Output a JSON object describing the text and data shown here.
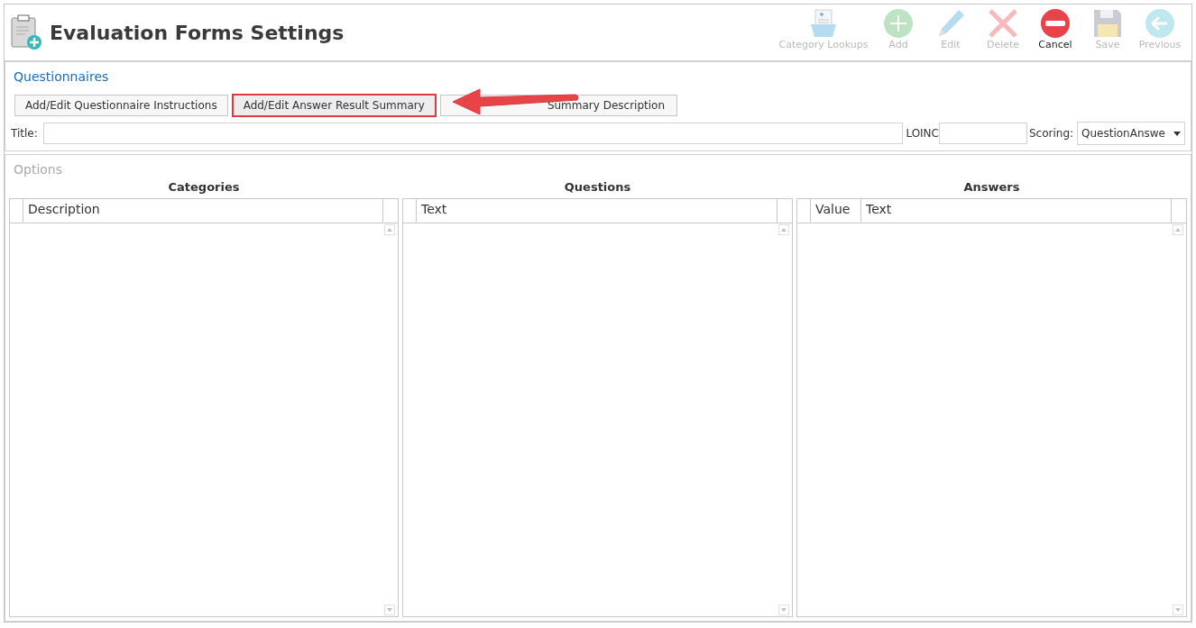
{
  "window": {
    "title": "Evaluation Forms Settings"
  },
  "toolbar": [
    {
      "label": "Category Lookups",
      "kind": "lookups",
      "disabled": true
    },
    {
      "label": "Add",
      "kind": "add",
      "disabled": true
    },
    {
      "label": "Edit",
      "kind": "edit",
      "disabled": true
    },
    {
      "label": "Delete",
      "kind": "delete",
      "disabled": true
    },
    {
      "label": "Cancel",
      "kind": "cancel",
      "disabled": false
    },
    {
      "label": "Save",
      "kind": "save",
      "disabled": true
    },
    {
      "label": "Previous",
      "kind": "previous",
      "disabled": true
    }
  ],
  "questionnaires": {
    "heading": "Questionnaires",
    "buttons": [
      {
        "label": "Add/Edit Questionnaire Instructions",
        "highlighted": false,
        "covered": false
      },
      {
        "label": "Add/Edit Answer Result Summary",
        "highlighted": true,
        "covered": false
      },
      {
        "label": "Summary Description",
        "highlighted": false,
        "covered": true
      }
    ],
    "title_label": "Title:",
    "loinc_label": "LOINC",
    "scoring_label": "Scoring:",
    "scoring_value": "QuestionAnswe"
  },
  "options": {
    "heading": "Options",
    "grids": [
      {
        "title": "Categories",
        "columns": [
          "Description"
        ]
      },
      {
        "title": "Questions",
        "columns": [
          "Text"
        ]
      },
      {
        "title": "Answers",
        "columns": [
          "Value",
          "Text"
        ]
      }
    ]
  }
}
